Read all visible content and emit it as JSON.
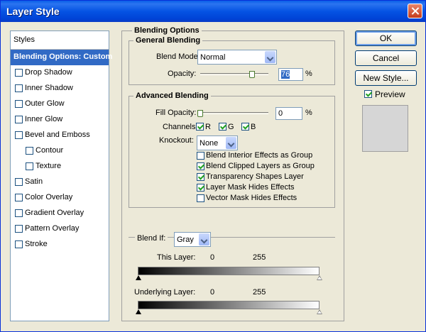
{
  "window": {
    "title": "Layer Style"
  },
  "styles_panel": {
    "header": "Styles",
    "items": [
      {
        "label": "Blending Options: Custom",
        "active": true,
        "checkbox": false,
        "checked": false
      },
      {
        "label": "Drop Shadow",
        "checked": false
      },
      {
        "label": "Inner Shadow",
        "checked": false
      },
      {
        "label": "Outer Glow",
        "checked": false
      },
      {
        "label": "Inner Glow",
        "checked": false
      },
      {
        "label": "Bevel and Emboss",
        "checked": false
      },
      {
        "label": "Contour",
        "checked": false
      },
      {
        "label": "Texture",
        "checked": false
      },
      {
        "label": "Satin",
        "checked": false
      },
      {
        "label": "Color Overlay",
        "checked": false
      },
      {
        "label": "Gradient Overlay",
        "checked": false
      },
      {
        "label": "Pattern Overlay",
        "checked": false
      },
      {
        "label": "Stroke",
        "checked": false
      }
    ]
  },
  "blending": {
    "title": "Blending Options",
    "general": {
      "title": "General Blending",
      "blend_mode_label": "Blend Mode:",
      "blend_mode_value": "Normal",
      "opacity_label": "Opacity:",
      "opacity_value": "76",
      "opacity_unit": "%",
      "opacity_level": 76
    },
    "advanced": {
      "title": "Advanced Blending",
      "fill_opacity_label": "Fill Opacity:",
      "fill_opacity_value": "0",
      "fill_opacity_unit": "%",
      "fill_opacity_level": 0,
      "channels_label": "Channels:",
      "channels": [
        {
          "label": "R",
          "checked": true
        },
        {
          "label": "G",
          "checked": true
        },
        {
          "label": "B",
          "checked": true
        }
      ],
      "knockout_label": "Knockout:",
      "knockout_value": "None",
      "options": [
        {
          "label": "Blend Interior Effects as Group",
          "checked": false
        },
        {
          "label": "Blend Clipped Layers as Group",
          "checked": true
        },
        {
          "label": "Transparency Shapes Layer",
          "checked": true
        },
        {
          "label": "Layer Mask Hides Effects",
          "checked": true
        },
        {
          "label": "Vector Mask Hides Effects",
          "checked": false
        }
      ]
    },
    "blend_if": {
      "label": "Blend If:",
      "value": "Gray",
      "this_layer_label": "This Layer:",
      "this_layer_min": "0",
      "this_layer_max": "255",
      "underlying_label": "Underlying Layer:",
      "underlying_min": "0",
      "underlying_max": "255"
    }
  },
  "buttons": {
    "ok": "OK",
    "cancel": "Cancel",
    "new_style": "New Style..."
  },
  "preview": {
    "label": "Preview",
    "checked": true
  },
  "colors": {
    "titlebar": "#0553e3",
    "selection": "#316ac5",
    "dialog_bg": "#ece9d8"
  }
}
